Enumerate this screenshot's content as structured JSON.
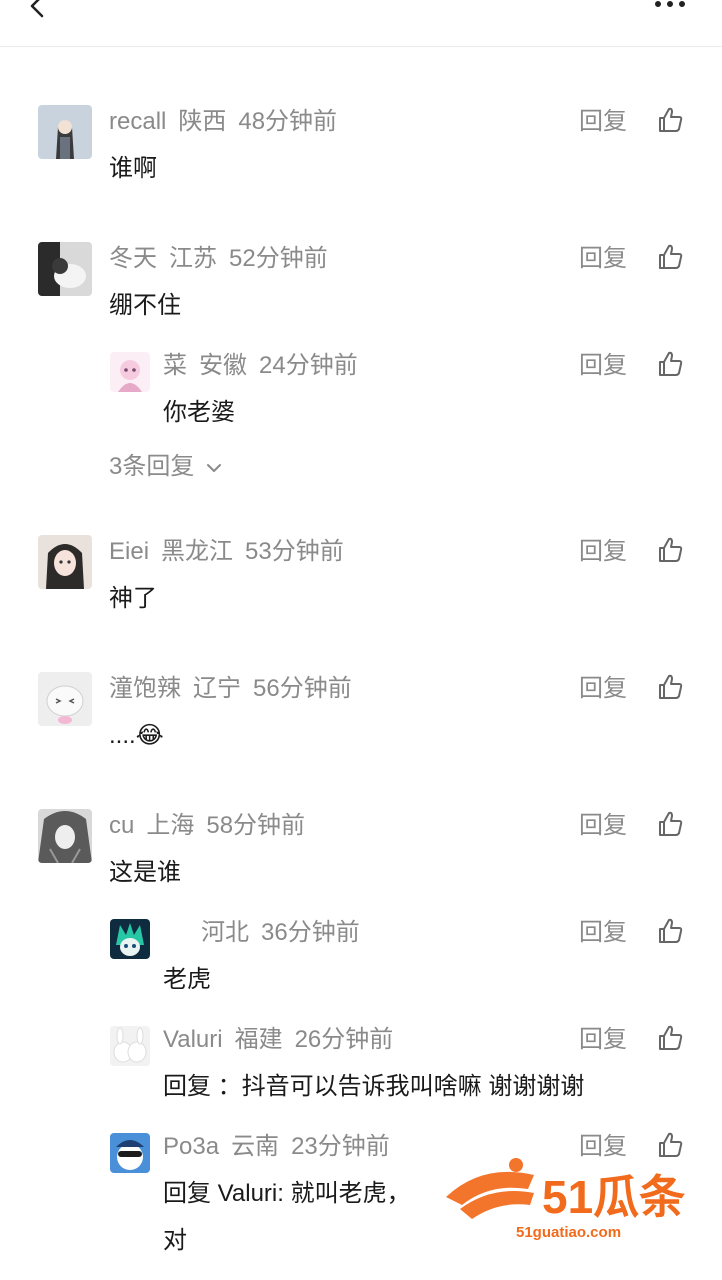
{
  "topbar": {
    "back_icon": "chevron-left-icon",
    "more_icon": "more-dots-icon"
  },
  "reply_label": "回复",
  "comments": [
    {
      "user": "recall",
      "region": "陕西",
      "time": "48分钟前",
      "text": "谁啊"
    },
    {
      "user": "冬天",
      "region": "江苏",
      "time": "52分钟前",
      "text": "绷不住"
    },
    {
      "user": "菜",
      "region": "安徽",
      "time": "24分钟前",
      "text": "你老婆"
    },
    {
      "user": "Eiei",
      "region": "黑龙江",
      "time": "53分钟前",
      "text": "神了"
    },
    {
      "user": "潼饱辣",
      "region": "辽宁",
      "time": "56分钟前",
      "text": "....😂"
    },
    {
      "user": "cu",
      "region": "上海",
      "time": "58分钟前",
      "text": "这是谁"
    },
    {
      "user": "",
      "region": "河北",
      "time": "36分钟前",
      "text": "老虎"
    },
    {
      "user": "Valuri",
      "region": "福建",
      "time": "26分钟前",
      "text": "回复 ：抖音可以告诉我叫啥嘛 谢谢谢谢"
    },
    {
      "user": "Po3a",
      "region": "云南",
      "time": "23分钟前",
      "text": "回复 Valuri: 就叫老虎，",
      "text2": "对"
    }
  ],
  "more_replies": "3条回复",
  "watermark": {
    "text": "51瓜条",
    "url": "51guatiao.com",
    "color": "#f26a1b"
  },
  "colors": {
    "meta": "#8a8a8a",
    "text": "#1a1a1a"
  }
}
